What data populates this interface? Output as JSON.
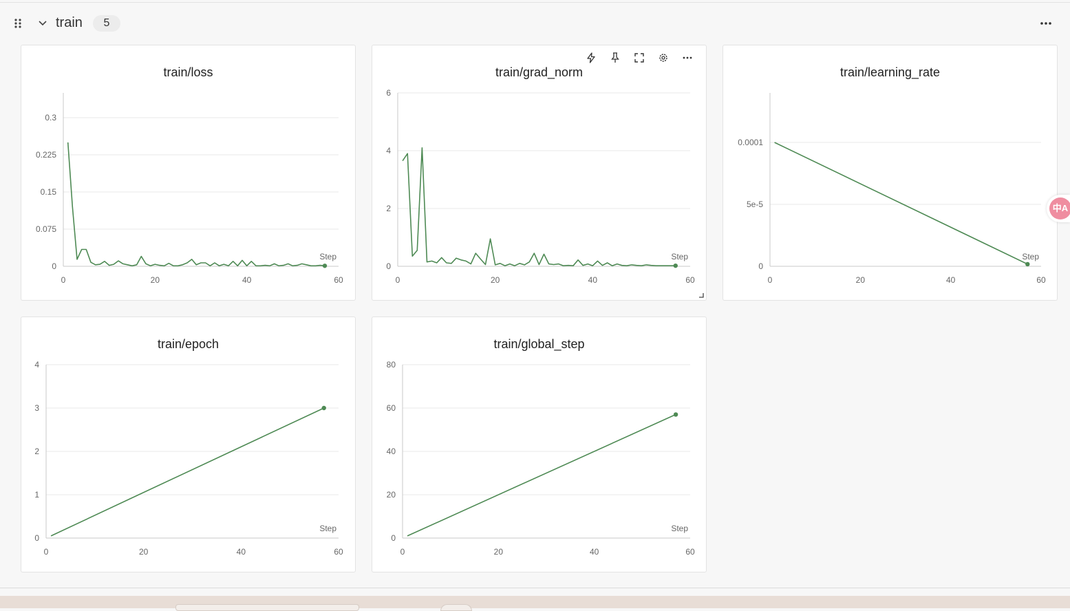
{
  "group": {
    "title": "train",
    "count": "5",
    "drag_icon": "drag-handle-icon",
    "collapse_icon": "chevron-down-icon",
    "more_icon": "more-horizontal-icon"
  },
  "card_toolbar_icons": [
    "lightning-icon",
    "pin-icon",
    "fullscreen-icon",
    "gear-icon",
    "more-horizontal-icon"
  ],
  "colors": {
    "line": "#4e8a54",
    "grid": "#e9e9e9",
    "axis": "#c8c8c8",
    "tick": "#666666"
  },
  "translate_widget": {
    "label": "中A",
    "icon": "translate-icon"
  },
  "chart_data": [
    {
      "type": "line",
      "title": "train/loss",
      "xlabel": "Step",
      "xlim": [
        0,
        60
      ],
      "ylim": [
        0,
        0.35
      ],
      "xticks": [
        0,
        20,
        40,
        60
      ],
      "xtick_labels": [
        "0",
        "20",
        "40",
        "60"
      ],
      "yticks": [
        0,
        0.075,
        0.15,
        0.225,
        0.3
      ],
      "ytick_labels": [
        "0",
        "0.075",
        "0.15",
        "0.225",
        "0.3"
      ],
      "grid": true,
      "x": [
        1,
        2,
        3,
        4,
        5,
        6,
        7,
        8,
        9,
        10,
        11,
        12,
        13,
        14,
        15,
        16,
        17,
        18,
        19,
        20,
        21,
        22,
        23,
        24,
        25,
        26,
        27,
        28,
        29,
        30,
        31,
        32,
        33,
        34,
        35,
        36,
        37,
        38,
        39,
        40,
        41,
        42,
        43,
        44,
        45,
        46,
        47,
        48,
        49,
        50,
        51,
        52,
        53,
        54,
        55,
        56,
        57
      ],
      "series": [
        {
          "values": [
            0.25,
            0.12,
            0.014,
            0.034,
            0.034,
            0.008,
            0.003,
            0.004,
            0.01,
            0.002,
            0.004,
            0.011,
            0.005,
            0.003,
            0.001,
            0.003,
            0.02,
            0.005,
            0.001,
            0.004,
            0.002,
            0.001,
            0.006,
            0.001,
            0.001,
            0.003,
            0.007,
            0.014,
            0.003,
            0.007,
            0.007,
            0.001,
            0.007,
            0.001,
            0.004,
            0.001,
            0.01,
            0.001,
            0.012,
            0.001,
            0.01,
            0.001,
            0.001,
            0.002,
            0.001,
            0.005,
            0.001,
            0.002,
            0.005,
            0.001,
            0.002,
            0.005,
            0.003,
            0.001,
            0.001,
            0.002,
            0.001
          ]
        }
      ]
    },
    {
      "type": "line",
      "title": "train/grad_norm",
      "xlabel": "Step",
      "xlim": [
        0,
        60
      ],
      "ylim": [
        0,
        6
      ],
      "xticks": [
        0,
        20,
        40,
        60
      ],
      "xtick_labels": [
        "0",
        "20",
        "40",
        "60"
      ],
      "yticks": [
        0,
        2,
        4,
        6
      ],
      "ytick_labels": [
        "0",
        "2",
        "4",
        "6"
      ],
      "grid": true,
      "x": [
        1,
        2,
        3,
        4,
        5,
        6,
        7,
        8,
        9,
        10,
        11,
        12,
        13,
        14,
        15,
        16,
        17,
        18,
        19,
        20,
        21,
        22,
        23,
        24,
        25,
        26,
        27,
        28,
        29,
        30,
        31,
        32,
        33,
        34,
        35,
        36,
        37,
        38,
        39,
        40,
        41,
        42,
        43,
        44,
        45,
        46,
        47,
        48,
        49,
        50,
        51,
        52,
        53,
        54,
        55,
        56,
        57
      ],
      "series": [
        {
          "values": [
            3.65,
            3.9,
            0.35,
            0.55,
            4.1,
            0.15,
            0.18,
            0.12,
            0.3,
            0.12,
            0.1,
            0.28,
            0.22,
            0.18,
            0.08,
            0.45,
            0.25,
            0.06,
            0.95,
            0.05,
            0.1,
            0.02,
            0.08,
            0.02,
            0.1,
            0.05,
            0.15,
            0.45,
            0.06,
            0.42,
            0.08,
            0.06,
            0.08,
            0.02,
            0.03,
            0.02,
            0.22,
            0.03,
            0.08,
            0.02,
            0.18,
            0.03,
            0.12,
            0.02,
            0.08,
            0.03,
            0.02,
            0.05,
            0.03,
            0.02,
            0.05,
            0.03,
            0.02,
            0.02,
            0.02,
            0.02,
            0.02
          ]
        }
      ]
    },
    {
      "type": "line",
      "title": "train/learning_rate",
      "xlabel": "Step",
      "xlim": [
        0,
        60
      ],
      "ylim": [
        0,
        0.00014
      ],
      "xticks": [
        0,
        20,
        40,
        60
      ],
      "xtick_labels": [
        "0",
        "20",
        "40",
        "60"
      ],
      "yticks": [
        0,
        5e-05,
        0.0001
      ],
      "ytick_labels": [
        "0",
        "5e-5",
        "0.0001"
      ],
      "grid": true,
      "x": [
        1,
        57
      ],
      "series": [
        {
          "values": [
            0.0001,
            1.7e-06
          ]
        }
      ]
    },
    {
      "type": "line",
      "title": "train/epoch",
      "xlabel": "Step",
      "xlim": [
        0,
        60
      ],
      "ylim": [
        0,
        4
      ],
      "xticks": [
        0,
        20,
        40,
        60
      ],
      "xtick_labels": [
        "0",
        "20",
        "40",
        "60"
      ],
      "yticks": [
        0,
        1,
        2,
        3,
        4
      ],
      "ytick_labels": [
        "0",
        "1",
        "2",
        "3",
        "4"
      ],
      "grid": true,
      "x": [
        1,
        19,
        38,
        57
      ],
      "series": [
        {
          "values": [
            0.05,
            1.0,
            2.0,
            3.0
          ]
        }
      ]
    },
    {
      "type": "line",
      "title": "train/global_step",
      "xlabel": "Step",
      "xlim": [
        0,
        60
      ],
      "ylim": [
        0,
        80
      ],
      "xticks": [
        0,
        20,
        40,
        60
      ],
      "xtick_labels": [
        "0",
        "20",
        "40",
        "60"
      ],
      "yticks": [
        0,
        20,
        40,
        60,
        80
      ],
      "ytick_labels": [
        "0",
        "20",
        "40",
        "60",
        "80"
      ],
      "grid": true,
      "x": [
        1,
        57
      ],
      "series": [
        {
          "values": [
            1,
            57
          ]
        }
      ]
    }
  ]
}
